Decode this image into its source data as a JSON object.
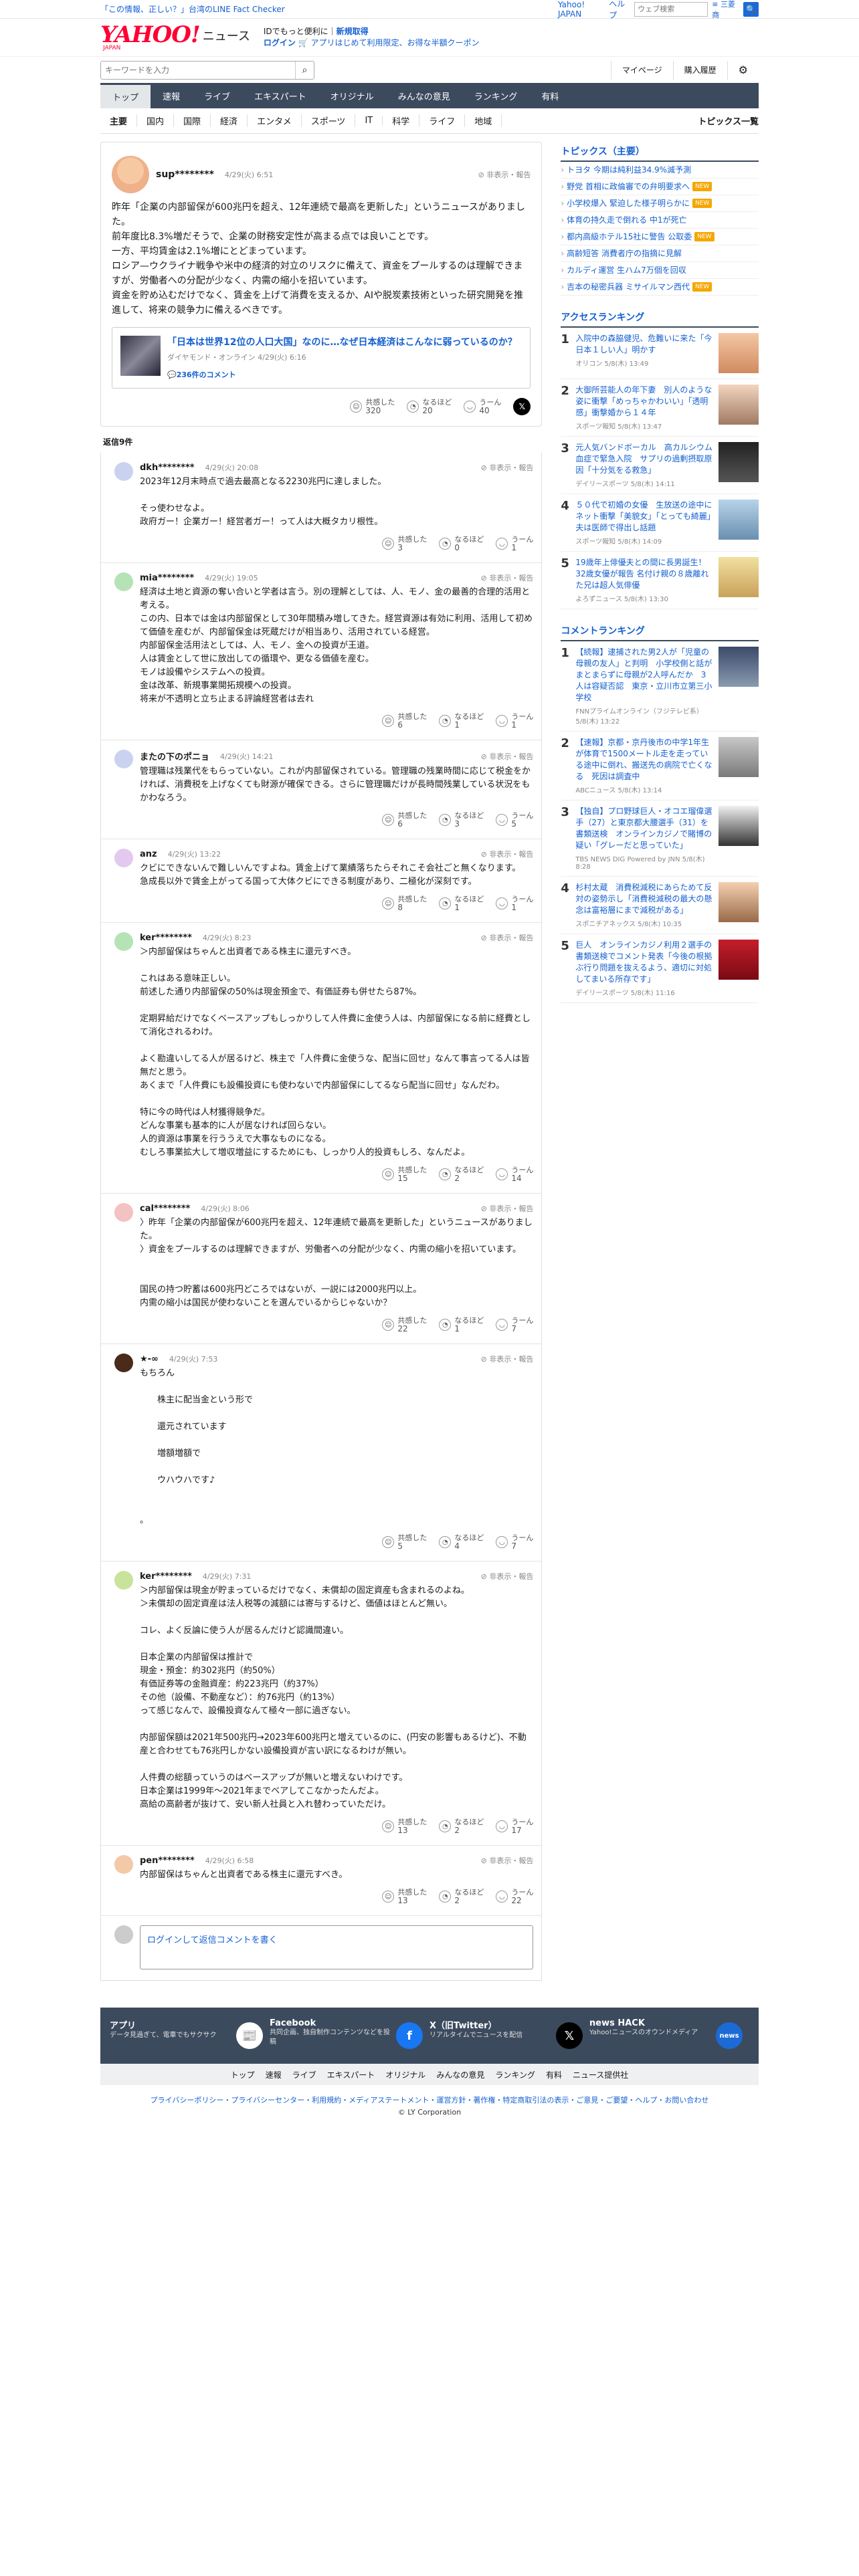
{
  "topbar": {
    "promo": "「この情報、正しい？」台湾のLINE Fact Checker",
    "links": [
      "Yahoo! JAPAN",
      "ヘルプ"
    ],
    "search_placeholder": "ウェブ検索",
    "search_button": "🔍",
    "more": "≡ 三菱商"
  },
  "brand": {
    "logo": "YAHOO!",
    "logo_sub": "JAPAN",
    "section": "ニュース",
    "line1_a": "IDでもっと便利に",
    "line1_b": "新規取得",
    "line2_a": "ログイン",
    "line2_b": "🛒 アプリはじめて利用限定、お得な半額クーポン"
  },
  "search": {
    "placeholder": "キーワードを入力",
    "mypage": "マイページ",
    "history": "購入履歴"
  },
  "nav": [
    "トップ",
    "速報",
    "ライブ",
    "エキスパート",
    "オリジナル",
    "みんなの意見",
    "ランキング",
    "有料"
  ],
  "subnav": [
    "主要",
    "国内",
    "国際",
    "経済",
    "エンタメ",
    "スポーツ",
    "IT",
    "科学",
    "ライフ",
    "地域"
  ],
  "subnav_topics": "トピックス一覧",
  "post": {
    "user": "sup********",
    "date": "4/29(火) 6:51",
    "report": "非表示・報告",
    "body": "昨年「企業の内部留保が600兆円を超え、12年連続で最高を更新した」というニュースがありました。\n前年度比8.3%増だそうで、企業の財務安定性が高まる点では良いことです。\n一方、平均賃金は2.1%増にとどまっています。\nロシア—ウクライナ戦争や米中の経済的対立のリスクに備えて、資金をプールするのは理解できますが、労働者への分配が少なく、内需の縮小を招いています。\n資金を貯め込むだけでなく、賃金を上げて消費を支えるか、AIや脱炭素技術といった研究開発を推進して、将来の競争力に備えるべきです。",
    "article_title": "「日本は世界12位の人口大国」なのに…なぜ日本経済はこんなに弱っているのか？",
    "article_meta": "ダイヤモンド・オンライン 4/29(火) 6:16",
    "article_comments": "236件のコメント",
    "reacts": [
      {
        "label": "共感した",
        "count": "320"
      },
      {
        "label": "なるほど",
        "count": "20"
      },
      {
        "label": "うーん",
        "count": "40"
      }
    ]
  },
  "reply_header": "返信9件",
  "replies": [
    {
      "user": "dkh********",
      "date": "4/29(火) 20:08",
      "body": "2023年12月末時点で過去最高となる2230兆円に達しました。\n\nそっ使わせなよ。\n政府ガー！企業ガー！経営者ガー！って人は大概タカリ根性。",
      "r": [
        "3",
        "0",
        "1"
      ]
    },
    {
      "user": "mia********",
      "date": "4/29(火) 19:05",
      "body": "経済は土地と資源の奪い合いと学者は言う。別の理解としては、人、モノ、金の最善的合理的活用と考える。\nこの内、日本では金は内部留保として30年間積み増してきた。経営資源は有効に利用、活用して初めて価値を産むが、内部留保金は死蔵だけが相当あり、活用されている経営。\n内部留保金活用法としては、人、モノ、金への投資が王道。\n人は賃金として世に放出しての循環や、更なる価値を産む。\nモノは設備やシステムへの投資。\n金は改革、新規事業開拓規模への投資。\n将来が不透明と立ち止まる評論経営者は去れ",
      "r": [
        "6",
        "1",
        "1"
      ]
    },
    {
      "user": "またの下のポニョ",
      "date": "4/29(火) 14:21",
      "body": "管理職は残業代をもらっていない。これが内部留保されている。管理職の残業時間に応じて税金をかければ、消費税を上げなくても財源が確保できる。さらに管理職だけが長時間残業している状況をもかわなろう。",
      "r": [
        "6",
        "3",
        "5"
      ]
    },
    {
      "user": "anz",
      "date": "4/29(火) 13:22",
      "body": "クビにできないんで難しいんですよね。賃金上げて業績落ちたらそれこそ会社ごと無くなります。\n急成長以外で賃金上がってる国って大体クビにできる制度があり、二極化が深刻です。",
      "r": [
        "8",
        "1",
        "1"
      ]
    },
    {
      "user": "ker********",
      "date": "4/29(火) 8:23",
      "body": "＞内部留保はちゃんと出資者である株主に還元すべき。\n\nこれはある意味正しい。\n前述した通り内部留保の50%は現金預金で、有価証券も併せたら87%。\n\n定期昇給だけでなくベースアップもしっかりして人件費に金使う人は、内部留保になる前に経費として消化されるわけ。\n\nよく勘違いしてる人が居るけど、株主で「人件費に金使うな、配当に回せ」なんて事言ってる人は皆無だと思う。\nあくまで「人件費にも設備投資にも使わないで内部留保にしてるなら配当に回せ」なんだわ。\n\n特に今の時代は人材獲得競争だ。\nどんな事業も基本的に人が居なければ回らない。\n人的資源は事業を行ううえで大事なものになる。\nむしろ事業拡大して増収増益にするためにも、しっかり人的投資もしろ、なんだよ。",
      "r": [
        "15",
        "2",
        "14"
      ]
    },
    {
      "user": "cal********",
      "date": "4/29(火) 8:06",
      "body": "〉昨年「企業の内部留保が600兆円を超え、12年連続で最高を更新した」というニュースがありました。\n〉資金をプールするのは理解できますが、労働者への分配が少なく、内需の縮小を招いています。\n\n\n国民の持つ貯蓄は600兆円どころではないが、一説には2000兆円以上。\n内需の縮小は国民が使わないことを選んでいるからじゃないか？",
      "r": [
        "22",
        "1",
        "7"
      ]
    },
    {
      "user": "★-∞",
      "date": "4/29(火) 7:53",
      "body": "もちろん\n\n　　株主に配当金という形で\n\n　　還元されています\n\n　　増額増額で\n\n　　ウハウハです♪\n\n\n。",
      "r": [
        "5",
        "4",
        "7"
      ]
    },
    {
      "user": "ker********",
      "date": "4/29(火) 7:31",
      "body": "＞内部留保は現金が貯まっているだけでなく、未償却の固定資産も含まれるのよね。\n＞未償却の固定資産は法人税等の減額には寄与するけど、価値はほとんど無い。\n\nコレ、よく反論に使う人が居るんだけど認識間違い。\n\n日本企業の内部留保は推計で\n現金・預金：約302兆円（約50%）\n有価証券等の金融資産：約223兆円（約37%）\nその他（設備、不動産など）：約76兆円（約13%）\nって感じなんで、設備投資なんて極々一部に過ぎない。\n\n内部留保額は2021年500兆円→2023年600兆円と増えているのに、(円安の影響もあるけど)、不動産と合わせても76兆円しかない設備投資が言い訳になるわけが無い。\n\n人件費の総額っていうのはベースアップが無いと増えないわけです。\n日本企業は1999年〜2021年までベアしてこなかったんだよ。\n高給の高齢者が抜けて、安い新人社員と入れ替わっていただけ。",
      "r": [
        "13",
        "2",
        "17"
      ]
    },
    {
      "user": "pen********",
      "date": "4/29(火) 6:58",
      "body": "内部留保はちゃんと出資者である株主に還元すべき。",
      "r": [
        "13",
        "2",
        "22"
      ]
    }
  ],
  "reply_input": "ログインして返信コメントを書く",
  "react_labels": [
    "共感した",
    "なるほど",
    "うーん"
  ],
  "sidebar": {
    "topics_title": "トピックス（主要）",
    "topics": [
      {
        "t": "トヨタ 今期は純利益34.9%減予測",
        "new": false
      },
      {
        "t": "野党 首相に政倫審での弁明要求へ",
        "new": true
      },
      {
        "t": "小学校爆入 緊迫した様子明らかに",
        "new": true
      },
      {
        "t": "体育の持久走で倒れる 中1が死亡",
        "new": false
      },
      {
        "t": "都内高級ホテル15社に警告 公取委",
        "new": true
      },
      {
        "t": "高齢短答 消費者庁の指摘に見解",
        "new": false
      },
      {
        "t": "カルディ運営 生ハム7万個を回収",
        "new": false
      },
      {
        "t": "吉本の秘密兵器 ミサイルマン西代",
        "new": true
      }
    ],
    "access_title": "アクセスランキング",
    "access": [
      {
        "t": "入院中の森脇健児、危難いに来た「今日本１しい人」明かす",
        "m": "オリコン 5/8(木) 13:49"
      },
      {
        "t": "大御所芸能人の年下妻　別人のような姿に衝撃「めっちゃかわいい」「透明感」衝撃婚から１４年",
        "m": "スポーツ報知 5/8(木) 13:47"
      },
      {
        "t": "元人気バンドボーカル　高カルシウム血症で緊急入院　サプリの過剰摂取原因「十分気をる救急」",
        "m": "デイリースポーツ 5/8(木) 14:11"
      },
      {
        "t": "５０代で初婚の女優　生放送の途中にネット衝撃「美貌女」「とっても綺麗」夫は医師で得出し話題",
        "m": "スポーツ報知 5/8(木) 14:09"
      },
      {
        "t": "19歳年上俳優夫との間に長男誕生！32歳女優が報告 名付け親の８歳離れた兄は超人気俳優",
        "m": "よろずニュース 5/8(木) 13:30"
      }
    ],
    "comment_title": "コメントランキング",
    "comments": [
      {
        "t": "【続報】逮捕された男2人が「児童の母親の友人」と判明　小学校側と話がまとまらずに母親が2人呼んだか　3人は容疑否認　東京・立川市立第三小学校",
        "m": "FNNプライムオンライン（フジテレビ系） 5/8(木) 13:22"
      },
      {
        "t": "【速報】京都・京丹後市の中学1年生が体育で1500メートル走を走っている途中に倒れ、搬送先の病院で亡くなる　死因は調査中",
        "m": "ABCニュース 5/8(木) 13:14"
      },
      {
        "t": "【独自】プロ野球巨人・オコエ瑠偉選手（27）と東京都大腰選手（31）を書類送検　オンラインカジノで賭博の疑い「グレーだと思っていた」",
        "m": "TBS NEWS DIG Powered by JNN 5/8(木) 8:28"
      },
      {
        "t": "杉村太蔵　消費税減税にあらためて反対の姿勢示し「消費税減税の最大の懸念は富裕層にまで減税がある」",
        "m": "スポニチアネックス 5/8(木) 10:35"
      },
      {
        "t": "巨人　オンラインカジノ利用２選手の書類送検でコメント発表「今後の根拠ぶ行り問題を抜えるよう、適切に対処してまいる所存です」",
        "m": "デイリースポーツ 5/8(木) 11:16"
      }
    ]
  },
  "footer": [
    {
      "title": "アプリ",
      "desc": "データ見過ぎて、電車でもサクサク",
      "icon": "📰",
      "color": "#ffffff"
    },
    {
      "title": "Facebook",
      "desc": "共同企画、独自制作コンテンツなどを投稿",
      "icon": "f",
      "color": "#1877f2"
    },
    {
      "title": "X（旧Twitter）",
      "desc": "リアルタイムでニュースを配信",
      "icon": "𝕏",
      "color": "#000000"
    },
    {
      "title": "news HACK",
      "desc": "Yahoo!ニュースのオウンドメディア",
      "icon": "news",
      "color": "#1c6ad6"
    }
  ],
  "footer_nav": [
    "トップ",
    "速報",
    "ライブ",
    "エキスパート",
    "オリジナル",
    "みんなの意見",
    "ランキング",
    "有料",
    "ニュース提供社"
  ],
  "legal": "プライバシーポリシー・プライバシーセンター・利用規約・メディアステートメント・運営方針・著作権・特定商取引法の表示・ご意見・ご要望・ヘルプ・お問い合わせ",
  "copyright": "© LY Corporation"
}
